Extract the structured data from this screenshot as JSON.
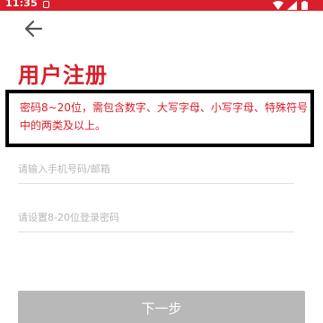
{
  "status_bar": {
    "time": "11:35",
    "background": "#d81e2a"
  },
  "header": {
    "back_icon": "arrow-left-icon"
  },
  "page": {
    "title": "用户注册",
    "hint": "密码8~20位，需包含数字、大写字母、小写字母、特殊符号中的两类及以上。"
  },
  "form": {
    "account_placeholder": "请输入手机号码/邮箱",
    "password_placeholder": "请设置8-20位登录密码",
    "next_label": "下一步"
  },
  "colors": {
    "accent": "#d81e2a",
    "button_disabled": "#b8b8b8",
    "highlight_border": "#000000"
  }
}
